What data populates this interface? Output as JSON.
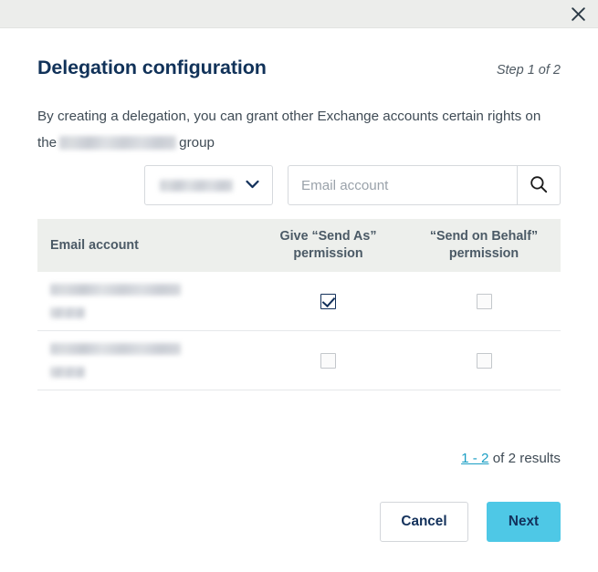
{
  "titlebar": {
    "close_icon": "close-icon"
  },
  "dialog": {
    "title": "Delegation configuration",
    "step": "Step 1 of 2",
    "intro_before": "By creating a delegation, you can grant other Exchange accounts certain rights on the",
    "intro_after": "group",
    "group_name_redacted": ""
  },
  "filter": {
    "domain_value_redacted": "",
    "chevron_icon": "chevron-down-icon",
    "search_value": "",
    "search_placeholder": "Email account",
    "search_icon": "search-icon"
  },
  "table": {
    "columns": [
      "Email account",
      "Give “Send As” permission",
      "“Send on Behalf” permission"
    ],
    "column_sendas_line1": "Give “Send As”",
    "column_sendas_line2": "permission",
    "column_behalf_line1": "“Send on Behalf”",
    "column_behalf_line2": "permission",
    "rows": [
      {
        "email_redacted": "",
        "send_as": true,
        "send_on_behalf": false
      },
      {
        "email_redacted": "",
        "send_as": false,
        "send_on_behalf": false
      }
    ]
  },
  "pagination": {
    "range_link": "1 - 2",
    "results_text": " of 2 results"
  },
  "footer": {
    "cancel_label": "Cancel",
    "next_label": "Next"
  },
  "colors": {
    "titlebar_bg": "#ecedeb",
    "title_navy": "#113259",
    "accent_cyan": "#4ec8e6",
    "link_teal": "#1a9ec4",
    "table_header_bg": "#edefec"
  }
}
